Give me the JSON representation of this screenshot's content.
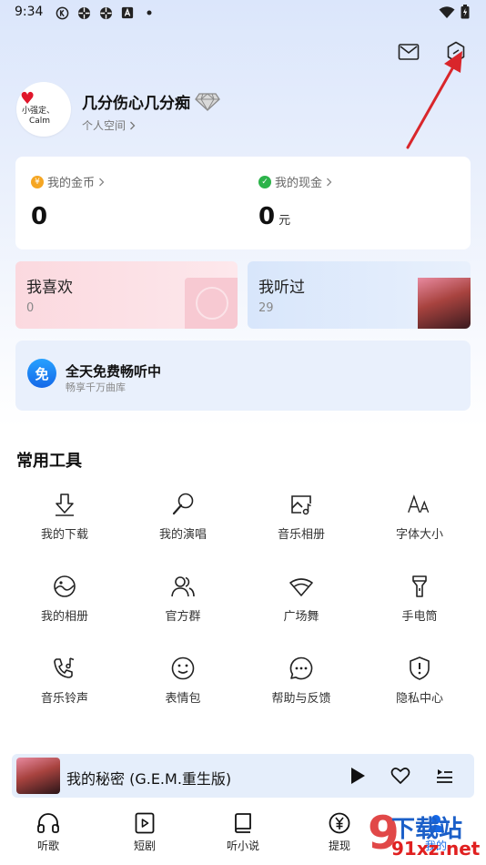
{
  "status_bar": {
    "time": "9:34"
  },
  "profile": {
    "avatar_text_1": "小强定、",
    "avatar_text_2": "Calm",
    "nickname": "几分伤心几分痴",
    "space_link": "个人空间"
  },
  "wallet": {
    "coins_label": "我的金币",
    "coins_value": "0",
    "cash_label": "我的现金",
    "cash_value": "0",
    "cash_unit": "元"
  },
  "tiles": {
    "like": {
      "title": "我喜欢",
      "count": "0"
    },
    "history": {
      "title": "我听过",
      "count": "29"
    }
  },
  "banner": {
    "icon_text": "免",
    "title": "全天免费畅听中",
    "subtitle": "畅享千万曲库"
  },
  "tools": {
    "title": "常用工具",
    "items": [
      {
        "label": "我的下载",
        "icon": "download-icon"
      },
      {
        "label": "我的演唱",
        "icon": "microphone-icon"
      },
      {
        "label": "音乐相册",
        "icon": "music-album-icon"
      },
      {
        "label": "字体大小",
        "icon": "font-size-icon"
      },
      {
        "label": "我的相册",
        "icon": "photo-album-icon"
      },
      {
        "label": "官方群",
        "icon": "group-icon"
      },
      {
        "label": "广场舞",
        "icon": "fan-dance-icon"
      },
      {
        "label": "手电筒",
        "icon": "flashlight-icon"
      },
      {
        "label": "音乐铃声",
        "icon": "ringtone-icon"
      },
      {
        "label": "表情包",
        "icon": "emoji-icon"
      },
      {
        "label": "帮助与反馈",
        "icon": "feedback-icon"
      },
      {
        "label": "隐私中心",
        "icon": "privacy-shield-icon"
      }
    ]
  },
  "player": {
    "song": "我的秘密 (G.E.M.重生版)"
  },
  "nav": {
    "items": [
      {
        "label": "听歌"
      },
      {
        "label": "短剧"
      },
      {
        "label": "听小说"
      },
      {
        "label": "提现"
      },
      {
        "label": "我的"
      }
    ]
  },
  "watermark": {
    "num": "9",
    "text_a": "下载站",
    "text_b": "91xz.net"
  },
  "colors": {
    "accent_blue": "#1468e8",
    "arrow_red": "#d9262b"
  }
}
